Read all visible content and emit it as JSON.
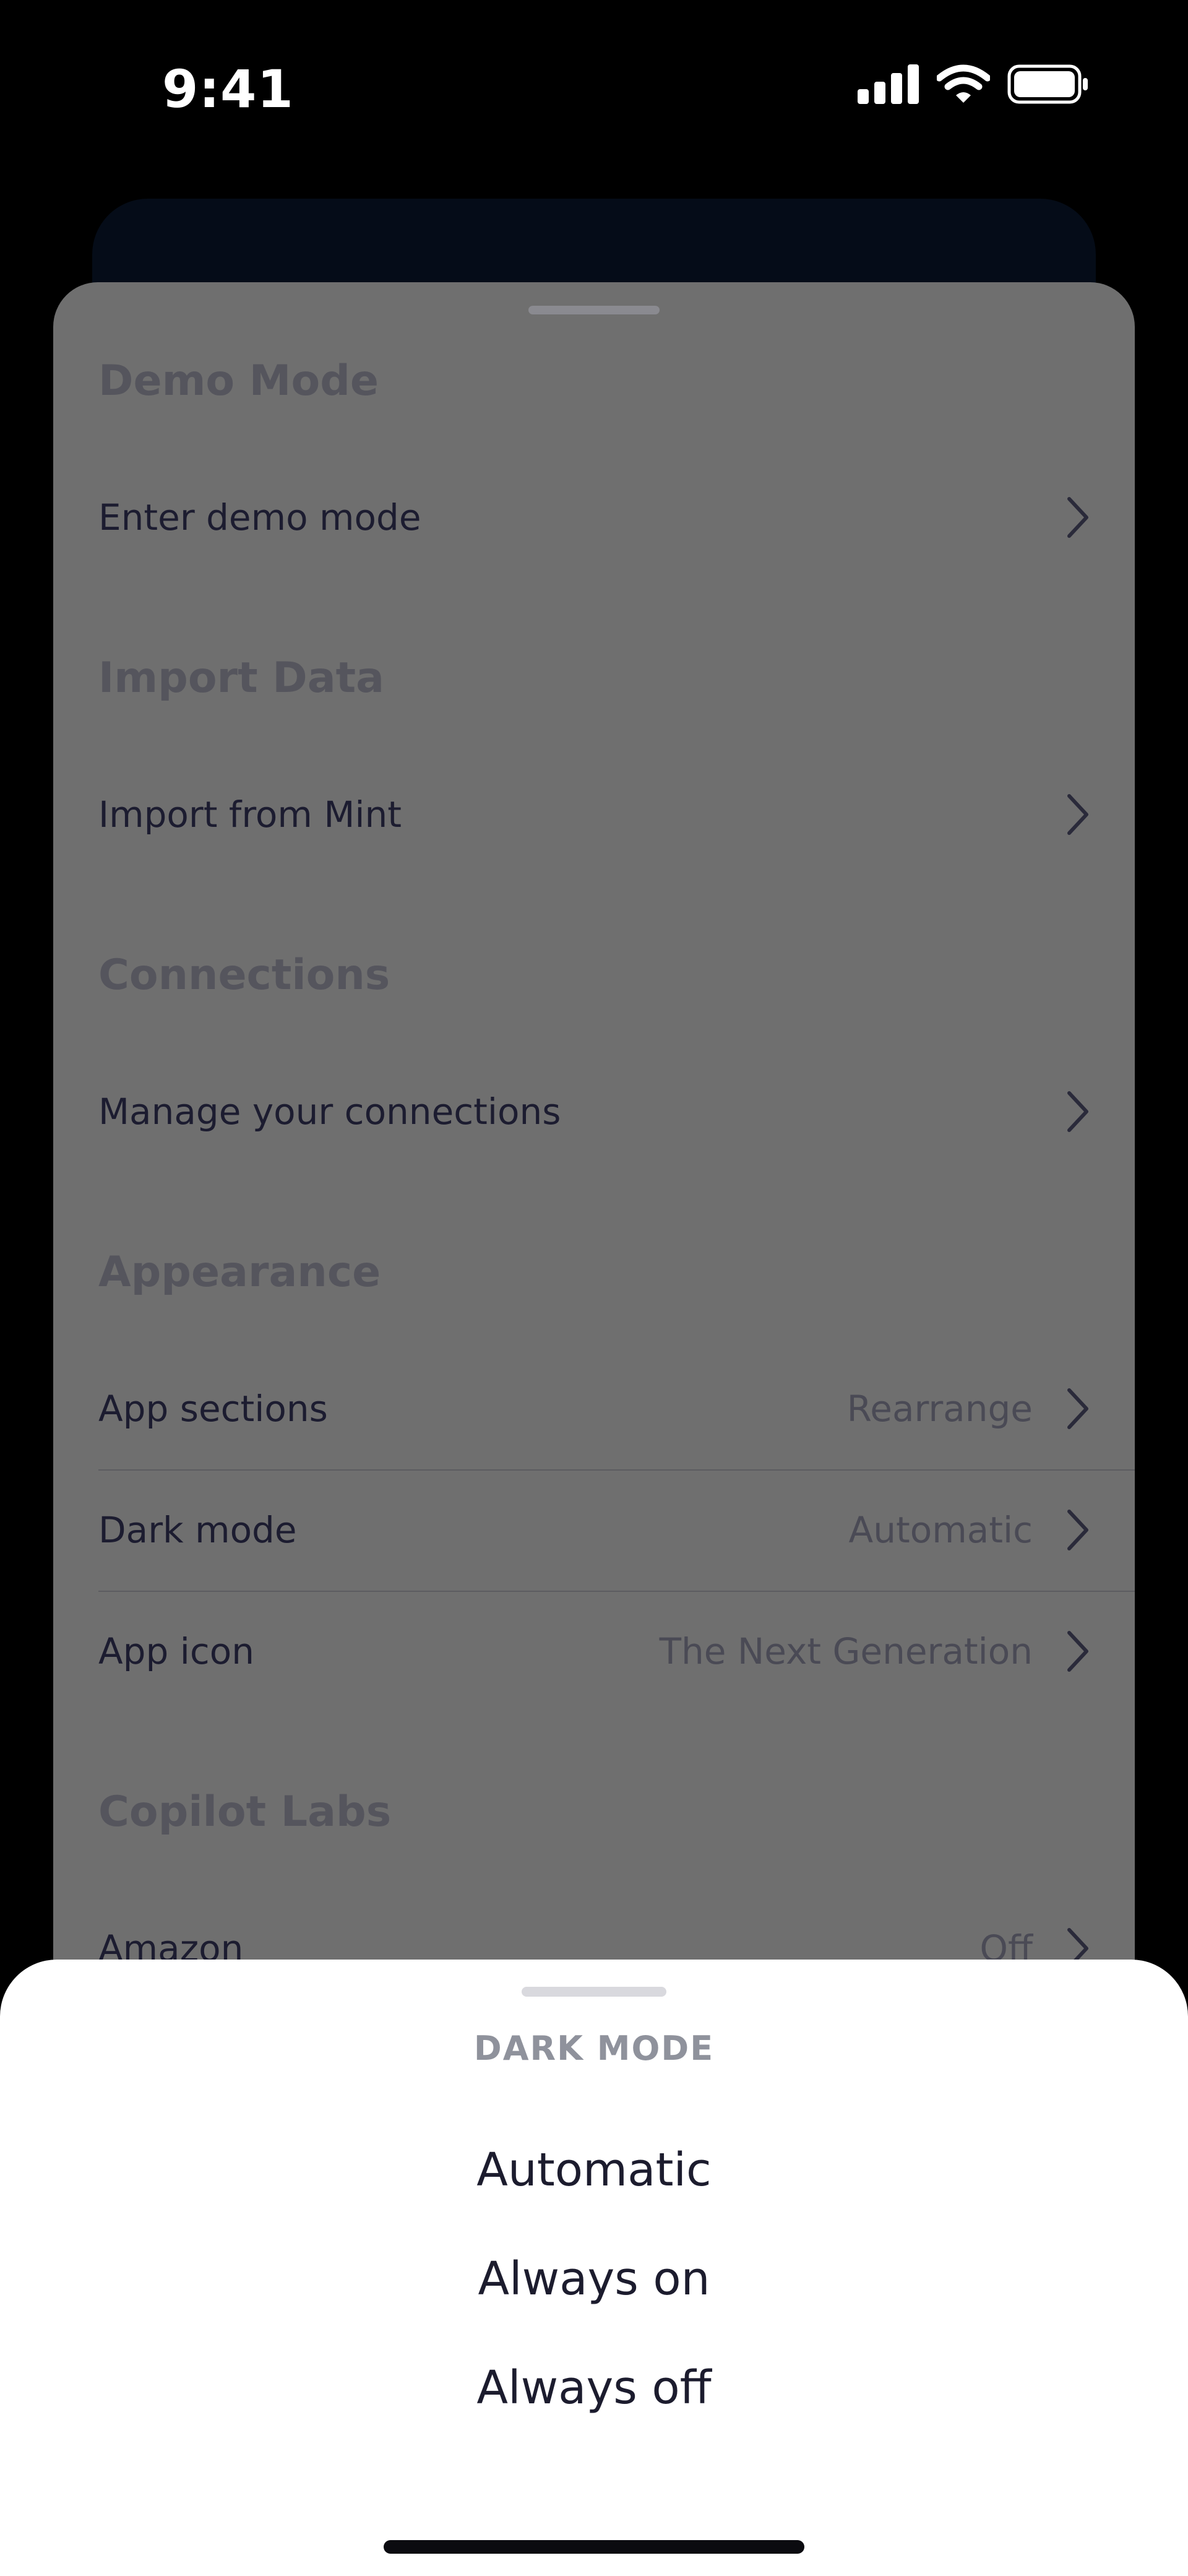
{
  "status_bar": {
    "time": "9:41"
  },
  "settings": {
    "sections": [
      {
        "title": "Demo Mode",
        "rows": [
          {
            "label": "Enter demo mode",
            "value": ""
          }
        ]
      },
      {
        "title": "Import Data",
        "rows": [
          {
            "label": "Import from Mint",
            "value": ""
          }
        ]
      },
      {
        "title": "Connections",
        "rows": [
          {
            "label": "Manage your connections",
            "value": ""
          }
        ]
      },
      {
        "title": "Appearance",
        "rows": [
          {
            "label": "App sections",
            "value": "Rearrange"
          },
          {
            "label": "Dark mode",
            "value": "Automatic"
          },
          {
            "label": "App icon",
            "value": "The Next Generation"
          }
        ]
      },
      {
        "title": "Copilot Labs",
        "rows": [
          {
            "label": "Amazon",
            "value": "Off"
          }
        ]
      }
    ]
  },
  "action_sheet": {
    "title": "DARK MODE",
    "options": [
      "Automatic",
      "Always on",
      "Always off"
    ]
  }
}
